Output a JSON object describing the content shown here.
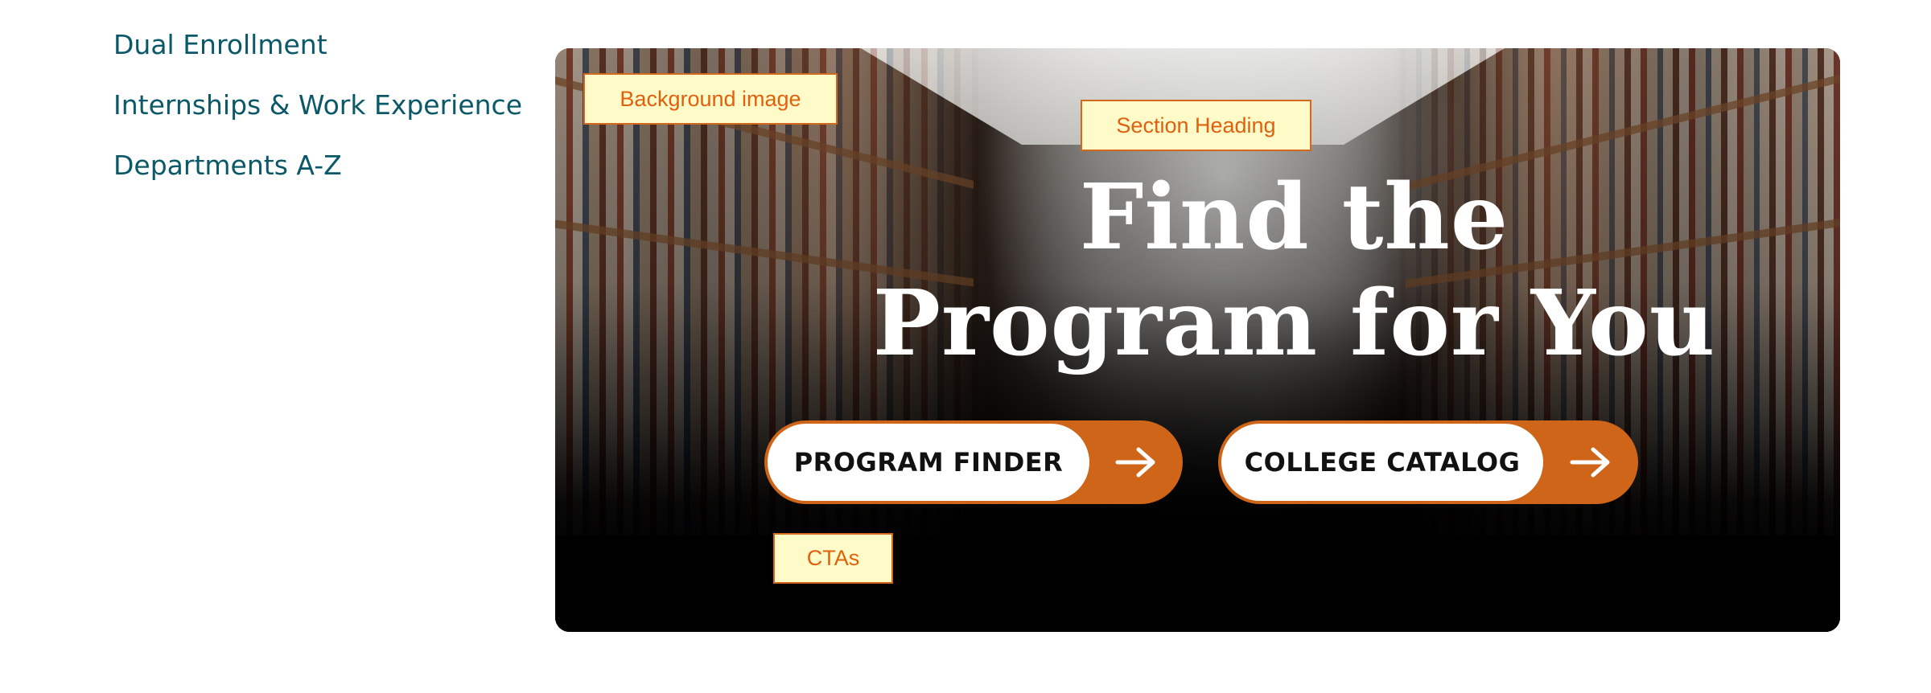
{
  "side_nav": {
    "links": [
      {
        "label": "Dual Enrollment"
      },
      {
        "label": "Internships & Work Experience"
      },
      {
        "label": "Departments A-Z"
      }
    ]
  },
  "hero": {
    "title_line1": "Find the",
    "title_line2": "Program for You",
    "ctas": [
      {
        "label": "PROGRAM FINDER",
        "icon": "arrow-right-icon"
      },
      {
        "label": "COLLEGE CATALOG",
        "icon": "arrow-right-icon"
      }
    ]
  },
  "annotations": {
    "background_image": "Background image",
    "section_heading": "Section Heading",
    "ctas": "CTAs"
  },
  "colors": {
    "link": "#0b5868",
    "accent": "#cf6518",
    "annotation_fill": "#fffbc8",
    "annotation_text": "#e0600f"
  }
}
